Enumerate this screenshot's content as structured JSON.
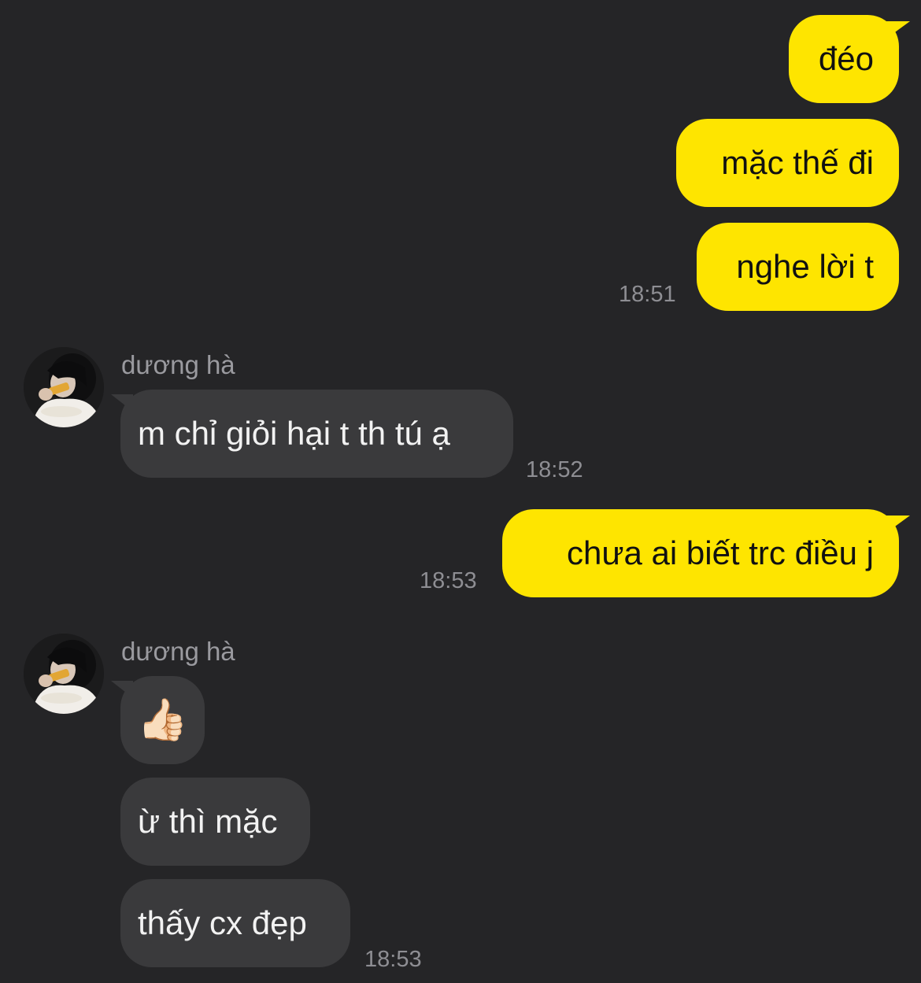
{
  "colors": {
    "background": "#252527",
    "my_bubble": "#fee500",
    "their_bubble": "#3a3a3c",
    "timestamp": "#8e8e93"
  },
  "messages": {
    "m1": "đéo",
    "m2": "mặc thế đi",
    "m3": "nghe lời t",
    "t1": "18:51",
    "sender1": "dương hà",
    "m4": "m chỉ giỏi hại t th tú ạ",
    "t2": "18:52",
    "m5": "chưa ai biết trc điều j",
    "t3": "18:53",
    "sender2": "dương hà",
    "m6_icon": "thumbs-up-icon",
    "m6": "👍🏻",
    "m7": "ừ thì mặc",
    "m8": "thấy cx đẹp",
    "t4": "18:53"
  }
}
